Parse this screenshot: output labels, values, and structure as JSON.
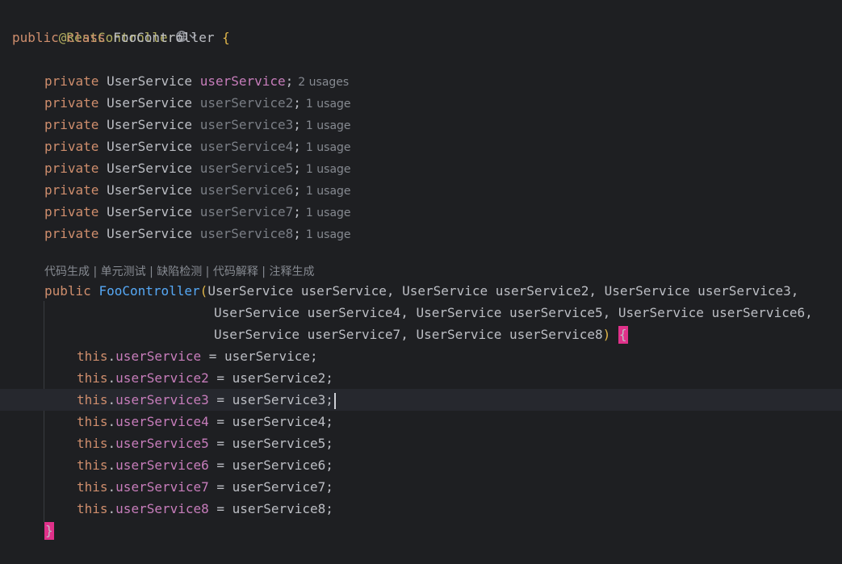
{
  "annotation": "@RestController",
  "icons": {
    "globe": "globe-icon",
    "chevron": "chevron-down-icon"
  },
  "class_decl": {
    "kw1": "public",
    "kw2": "class",
    "name": "FooController",
    "brace": "{"
  },
  "fields": [
    {
      "kw": "private",
      "type": "UserService",
      "name": "userService",
      "semi": ";",
      "usages": "2 usages",
      "used": true
    },
    {
      "kw": "private",
      "type": "UserService",
      "name": "userService2",
      "semi": ";",
      "usages": "1 usage",
      "used": false
    },
    {
      "kw": "private",
      "type": "UserService",
      "name": "userService3",
      "semi": ";",
      "usages": "1 usage",
      "used": false
    },
    {
      "kw": "private",
      "type": "UserService",
      "name": "userService4",
      "semi": ";",
      "usages": "1 usage",
      "used": false
    },
    {
      "kw": "private",
      "type": "UserService",
      "name": "userService5",
      "semi": ";",
      "usages": "1 usage",
      "used": false
    },
    {
      "kw": "private",
      "type": "UserService",
      "name": "userService6",
      "semi": ";",
      "usages": "1 usage",
      "used": false
    },
    {
      "kw": "private",
      "type": "UserService",
      "name": "userService7",
      "semi": ";",
      "usages": "1 usage",
      "used": false
    },
    {
      "kw": "private",
      "type": "UserService",
      "name": "userService8",
      "semi": ";",
      "usages": "1 usage",
      "used": false
    }
  ],
  "code_lens": "代码生成 | 单元测试 | 缺陷检测 | 代码解释 | 注释生成",
  "ctor": {
    "kw": "public",
    "name": "FooController",
    "paren_open": "(",
    "params_line1": "UserService userService, UserService userService2, UserService userService3,",
    "params_line2": "UserService userService4, UserService userService5, UserService userService6,",
    "params_line3": "UserService userService7, UserService userService8",
    "paren_close": ")",
    "brace_open": "{",
    "brace_close": "}"
  },
  "assignments": [
    {
      "this": "this",
      "dot": ".",
      "field": "userService",
      "rest": " = userService;"
    },
    {
      "this": "this",
      "dot": ".",
      "field": "userService2",
      "rest": " = userService2;"
    },
    {
      "this": "this",
      "dot": ".",
      "field": "userService3",
      "rest": " = userService3;"
    },
    {
      "this": "this",
      "dot": ".",
      "field": "userService4",
      "rest": " = userService4;"
    },
    {
      "this": "this",
      "dot": ".",
      "field": "userService5",
      "rest": " = userService5;"
    },
    {
      "this": "this",
      "dot": ".",
      "field": "userService6",
      "rest": " = userService6;"
    },
    {
      "this": "this",
      "dot": ".",
      "field": "userService7",
      "rest": " = userService7;"
    },
    {
      "this": "this",
      "dot": ".",
      "field": "userService8",
      "rest": " = userService8;"
    }
  ],
  "colors": {
    "background": "#1e1f22",
    "keyword": "#cf8e6d",
    "annotation": "#b3ae60",
    "field": "#c77dbb",
    "method": "#56a8f5",
    "brace_match": "#e0318a"
  }
}
